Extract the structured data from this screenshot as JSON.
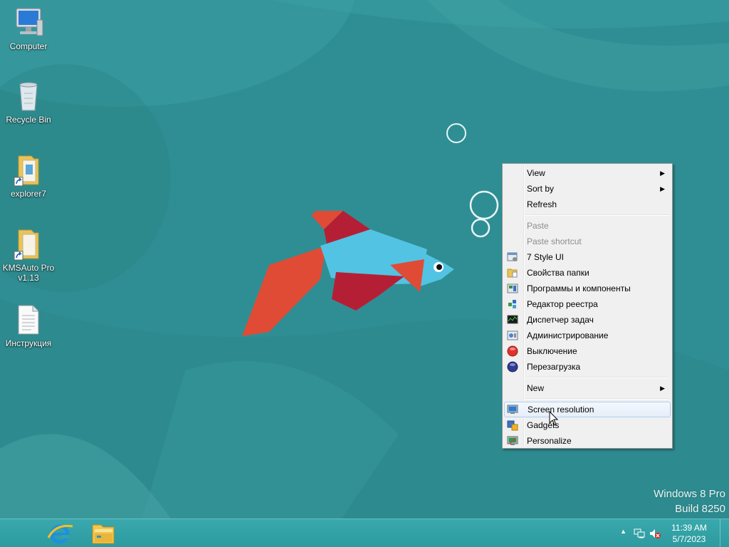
{
  "desktop": {
    "icons": [
      {
        "label": "Computer",
        "icon": "computer-icon"
      },
      {
        "label": "Recycle Bin",
        "icon": "recycle-bin-icon"
      },
      {
        "label": "explorer7",
        "icon": "folder-shortcut-icon"
      },
      {
        "label": "KMSAuto Pro\nv1.13",
        "icon": "folder-shortcut-icon"
      },
      {
        "label": "Инструкция",
        "icon": "text-document-icon"
      }
    ],
    "watermark": {
      "line1": "Windows 8 Pro",
      "line2": "Build 8250"
    }
  },
  "context_menu": {
    "items": {
      "view": {
        "label": "View",
        "submenu": true
      },
      "sort_by": {
        "label": "Sort by",
        "submenu": true
      },
      "refresh": {
        "label": "Refresh"
      },
      "paste": {
        "label": "Paste",
        "disabled": true
      },
      "paste_shortcut": {
        "label": "Paste shortcut",
        "disabled": true
      },
      "style_ui": {
        "label": "7 Style UI",
        "icon": "window-settings-icon"
      },
      "folder_props": {
        "label": "Свойства папки",
        "icon": "folder-options-icon"
      },
      "programs": {
        "label": "Программы и компоненты",
        "icon": "programs-icon"
      },
      "regedit": {
        "label": "Редактор реестра",
        "icon": "registry-editor-icon"
      },
      "taskmgr": {
        "label": "Диспетчер задач",
        "icon": "task-manager-icon"
      },
      "admin": {
        "label": "Администрирование",
        "icon": "admin-tools-icon"
      },
      "shutdown": {
        "label": "Выключение",
        "icon": "shutdown-icon"
      },
      "restart": {
        "label": "Перезагрузка",
        "icon": "restart-icon"
      },
      "new": {
        "label": "New",
        "submenu": true
      },
      "screen_res": {
        "label": "Screen resolution",
        "icon": "screen-resolution-icon",
        "hovered": true
      },
      "gadgets": {
        "label": "Gadgets",
        "icon": "gadgets-icon"
      },
      "personalize": {
        "label": "Personalize",
        "icon": "personalize-icon"
      }
    }
  },
  "taskbar": {
    "pinned": [
      {
        "name": "Internet Explorer",
        "icon": "internet-explorer-icon"
      },
      {
        "name": "File Explorer",
        "icon": "file-explorer-icon"
      }
    ],
    "tray": {
      "icons": [
        "show-hidden-icons-arrow-icon",
        "network-icon",
        "volume-muted-icon"
      ],
      "time": "11:39 AM",
      "date": "5/7/2023"
    }
  },
  "colors": {
    "wallpaper": "#2f8e93",
    "taskbar": "#35a3a7",
    "fish_body": "#52c3e3",
    "fish_fin_red": "#e04b36",
    "fish_fin_dark": "#b51f35"
  }
}
